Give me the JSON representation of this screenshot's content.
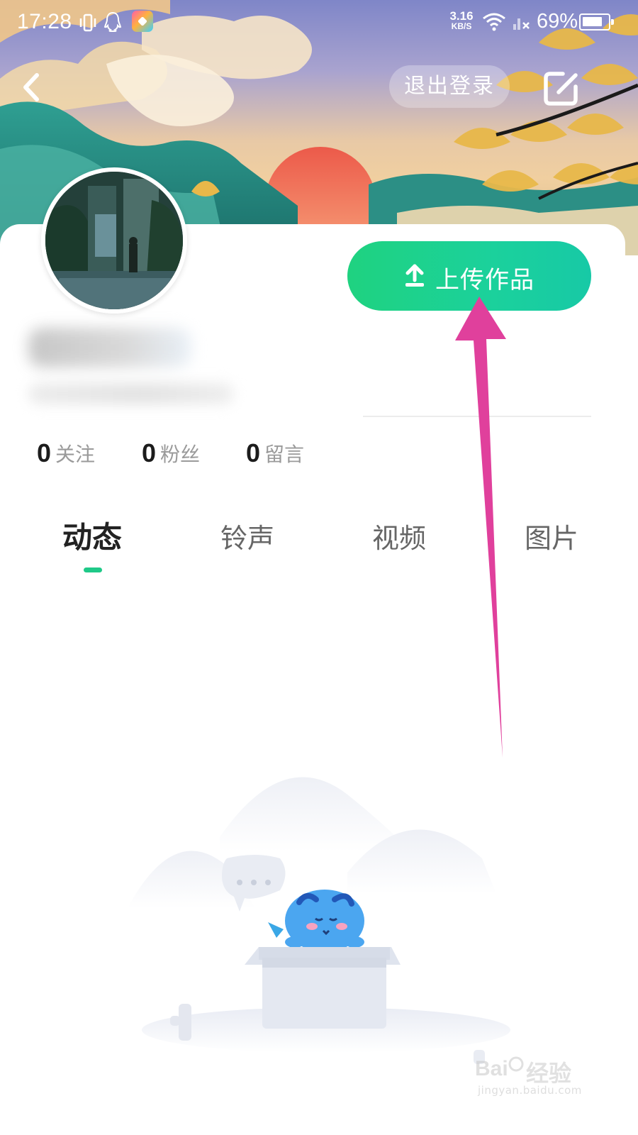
{
  "status_bar": {
    "time": "17:28",
    "net_speed_value": "3.16",
    "net_speed_unit": "KB/S",
    "battery_percent": "69%"
  },
  "header": {
    "logout_label": "退出登录"
  },
  "profile": {
    "upload_label": "上传作品",
    "stats": [
      {
        "count": "0",
        "label": "关注"
      },
      {
        "count": "0",
        "label": "粉丝"
      },
      {
        "count": "0",
        "label": "留言"
      }
    ]
  },
  "tabs": [
    {
      "label": "动态",
      "active": true
    },
    {
      "label": "铃声",
      "active": false
    },
    {
      "label": "视频",
      "active": false
    },
    {
      "label": "图片",
      "active": false
    }
  ],
  "watermark": {
    "word": "经验",
    "url": "jingyan.baidu.com"
  },
  "colors": {
    "accent": "#1fc988",
    "upload_gradient_start": "#1fd280",
    "upload_gradient_end": "#17c9a6",
    "annotation_arrow": "#e0409c"
  }
}
